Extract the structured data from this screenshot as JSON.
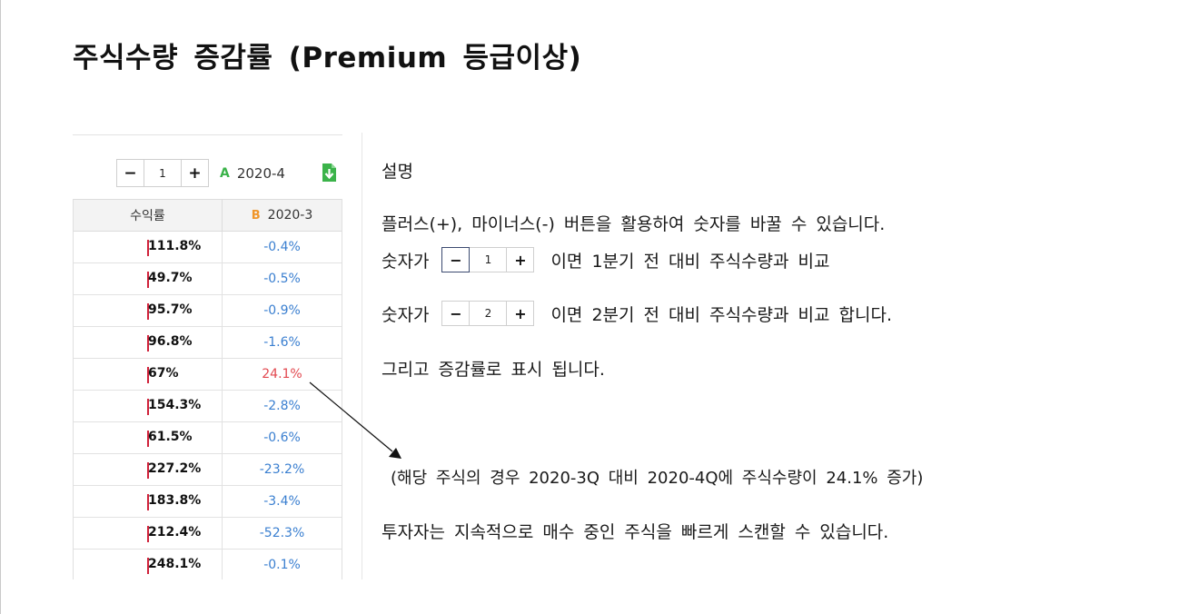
{
  "page": {
    "title": "주식수량 증감률 (Premium 등급이상)"
  },
  "controls": {
    "minus": "−",
    "plus": "+",
    "value": "1",
    "tag_a": "A",
    "period_a": "2020-4",
    "download_icon": "download-icon"
  },
  "table": {
    "header_col1": "수익률",
    "tag_b": "B",
    "header_col2": "2020-3",
    "rows": [
      {
        "yield": "111.8%",
        "change": "-0.4%"
      },
      {
        "yield": "49.7%",
        "change": "-0.5%"
      },
      {
        "yield": "95.7%",
        "change": "-0.9%"
      },
      {
        "yield": "96.8%",
        "change": "-1.6%"
      },
      {
        "yield": "67%",
        "change": "24.1%"
      },
      {
        "yield": "154.3%",
        "change": "-2.8%"
      },
      {
        "yield": "61.5%",
        "change": "-0.6%"
      },
      {
        "yield": "227.2%",
        "change": "-23.2%"
      },
      {
        "yield": "183.8%",
        "change": "-3.4%"
      },
      {
        "yield": "212.4%",
        "change": "-52.3%"
      },
      {
        "yield": "248.1%",
        "change": "-0.1%"
      }
    ],
    "colors": {
      "negative": "#3a7fd0",
      "positive": "#e2484f",
      "bar": "#d0213a"
    }
  },
  "description": {
    "title": "설명",
    "line1": "플러스(+), 마이너스(-) 버튼을 활용하여 숫자를 바꿀 수 있습니다.",
    "row1_prefix": "숫자가",
    "row1_value": "1",
    "row1_suffix": "이면 1분기 전 대비 주식수량과 비교",
    "row2_prefix": "숫자가",
    "row2_value": "2",
    "row2_suffix": "이면 2분기 전 대비 주식수량과 비교 합니다.",
    "line4": "그리고 증감률로 표시 됩니다.",
    "note": "(해당 주식의 경우 2020-3Q 대비 2020-4Q에 주식수량이 24.1% 증가)",
    "line6": "투자자는 지속적으로 매수 중인 주식을 빠르게 스캔할 수 있습니다.",
    "minus": "−",
    "plus": "+"
  }
}
